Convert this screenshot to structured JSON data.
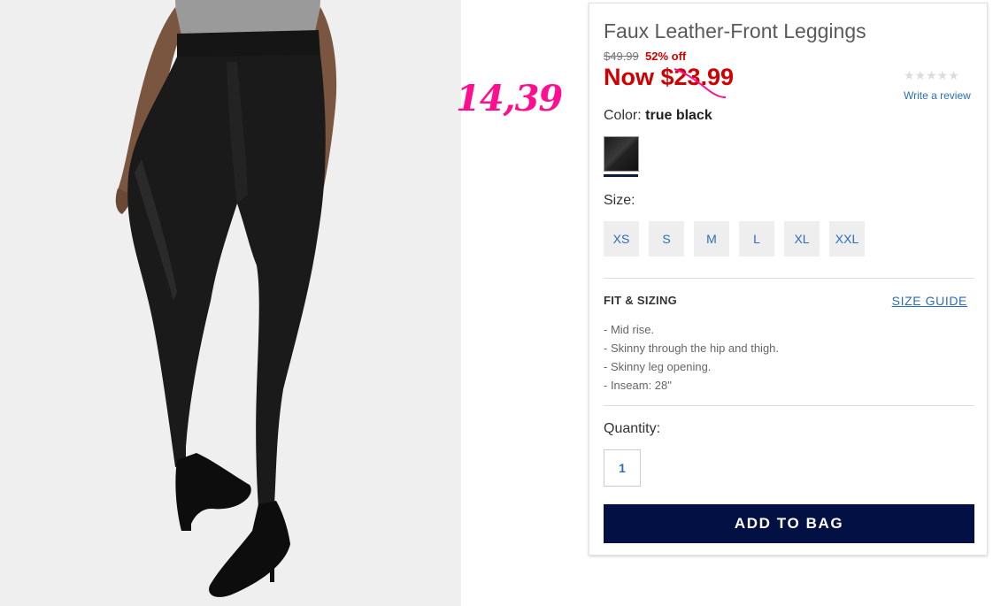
{
  "annotation": {
    "text": "14,39",
    "color": "#ff0f8f"
  },
  "product": {
    "title": "Faux Leather-Front Leggings",
    "old_price": "$49.99",
    "discount": "52% off",
    "now_price": "Now $23.99",
    "rating_stars": "★★★★★",
    "write_review": "Write a review",
    "color_label": "Color:",
    "color_value": "true black",
    "size_label": "Size:",
    "sizes": [
      "XS",
      "S",
      "M",
      "L",
      "XL",
      "XXL"
    ],
    "fit_title": "FIT & SIZING",
    "size_guide": "SIZE GUIDE",
    "fit_details": [
      "- Mid rise.",
      "- Skinny through the hip and thigh.",
      "- Skinny leg opening.",
      "- Inseam: 28\""
    ],
    "quantity_label": "Quantity:",
    "quantity_value": "1",
    "add_to_bag": "ADD TO BAG"
  },
  "colors": {
    "accent_link": "#2a6ebb",
    "sale_red": "#d00000",
    "button_navy": "#031044"
  }
}
